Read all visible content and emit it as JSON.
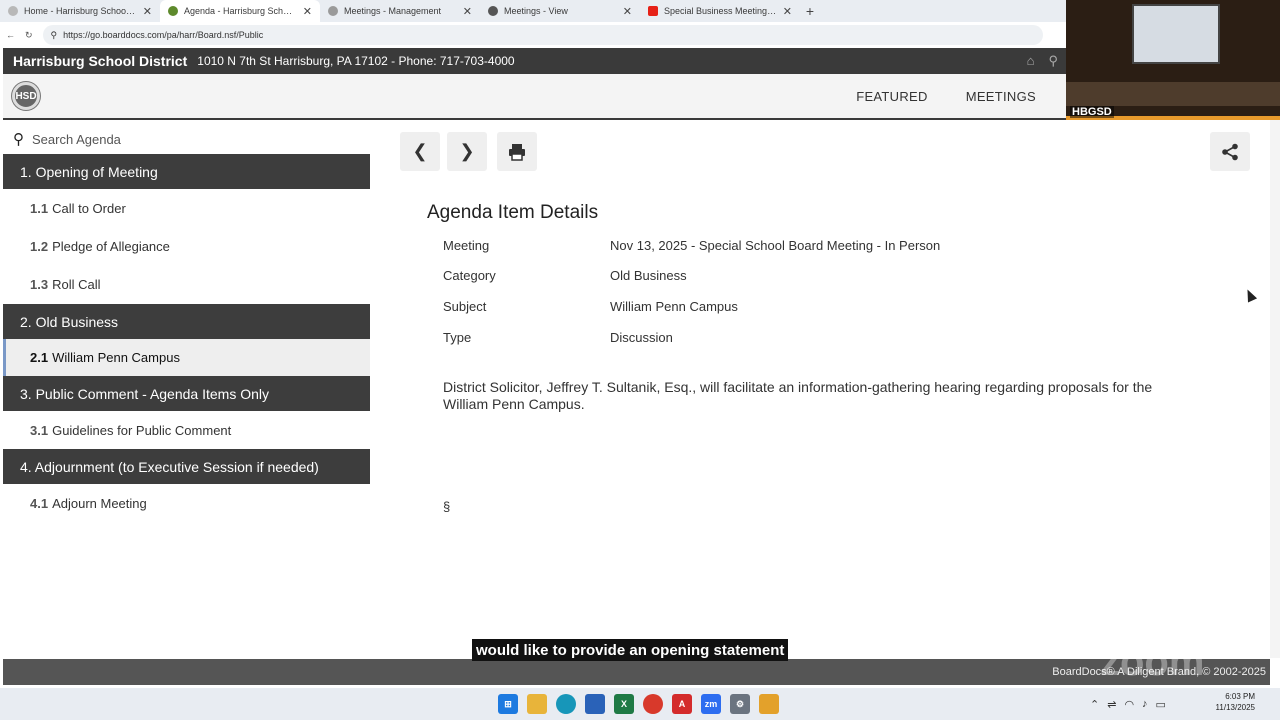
{
  "browser": {
    "tabs": [
      {
        "title": "Home - Harrisburg School Distric",
        "active": false,
        "fav_color": "#b8b8b8"
      },
      {
        "title": "Agenda - Harrisburg School Distr",
        "active": true,
        "fav_color": "#5e8a2c"
      },
      {
        "title": "Meetings - Management",
        "active": false,
        "fav_color": "#9a9a9a"
      },
      {
        "title": "Meetings - View",
        "active": false,
        "fav_color": "#555555"
      },
      {
        "title": "Special Business Meeting - YouT",
        "active": false,
        "fav_color": "#e62117"
      }
    ],
    "new_tab": "+",
    "url": "https://go.boarddocs.com/pa/harr/Board.nsf/Public"
  },
  "site": {
    "name": "Harrisburg School District",
    "address": "1010 N 7th St Harrisburg, PA 17102 - Phone: 717-703-4000",
    "nav": {
      "featured": "FEATURED",
      "meetings": "MEETINGS"
    }
  },
  "video": {
    "label": "HBGSD"
  },
  "sidebar": {
    "search_placeholder": "Search Agenda",
    "sections": [
      {
        "label": "1. Opening of Meeting",
        "items": [
          {
            "num": "1.1",
            "label": "Call to Order"
          },
          {
            "num": "1.2",
            "label": "Pledge of Allegiance"
          },
          {
            "num": "1.3",
            "label": "Roll Call"
          }
        ]
      },
      {
        "label": "2. Old Business",
        "items": [
          {
            "num": "2.1",
            "label": "William Penn Campus"
          }
        ]
      },
      {
        "label": "3. Public Comment - Agenda Items Only",
        "items": [
          {
            "num": "3.1",
            "label": "Guidelines for Public Comment"
          }
        ]
      },
      {
        "label": "4. Adjournment (to Executive Session if needed)",
        "items": [
          {
            "num": "4.1",
            "label": "Adjourn Meeting"
          }
        ]
      }
    ]
  },
  "details": {
    "title": "Agenda Item Details",
    "rows": [
      {
        "label": "Meeting",
        "value": "Nov 13, 2025 - Special School Board Meeting - In Person"
      },
      {
        "label": "Category",
        "value": "Old Business"
      },
      {
        "label": "Subject",
        "value": "William Penn Campus"
      },
      {
        "label": "Type",
        "value": "Discussion"
      }
    ],
    "description": "District Solicitor, Jeffrey T. Sultanik, Esq., will facilitate an information-gathering hearing regarding proposals for the William Penn Campus.",
    "section_mark": "§"
  },
  "caption": "would like to provide an opening statement",
  "footer": "BoardDocs® A Diligent Brand, © 2002-2025",
  "zoom_watermark": "zoom",
  "taskbar": {
    "time": "6:03 PM",
    "date": "11/13/2025"
  }
}
